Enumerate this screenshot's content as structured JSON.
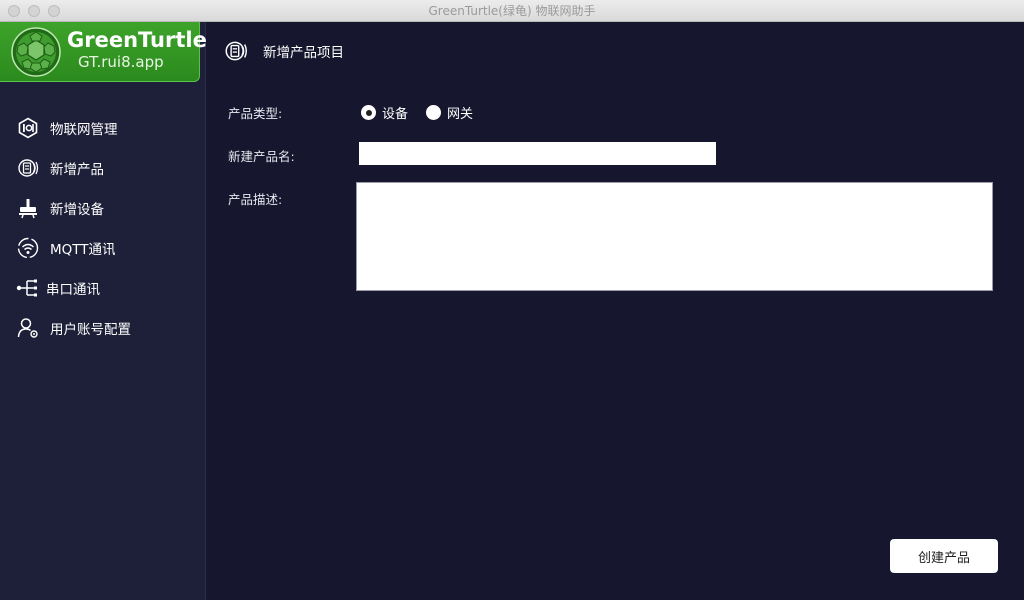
{
  "window": {
    "title": "GreenTurtle(绿龟) 物联网助手"
  },
  "logo": {
    "name": "GreenTurtle",
    "url": "GT.rui8.app"
  },
  "sidebar": {
    "items": [
      {
        "label": "物联网管理",
        "icon": "iot-icon"
      },
      {
        "label": "新增产品",
        "icon": "product-icon"
      },
      {
        "label": "新增设备",
        "icon": "device-icon"
      },
      {
        "label": "MQTT通讯",
        "icon": "mqtt-icon"
      },
      {
        "label": "串口通讯",
        "icon": "serial-icon"
      },
      {
        "label": "用户账号配置",
        "icon": "user-settings-icon"
      }
    ]
  },
  "main": {
    "header": {
      "title": "新增产品项目",
      "icon": "product-icon"
    },
    "form": {
      "type_label": "产品类型:",
      "type_options": [
        {
          "label": "设备",
          "checked": true
        },
        {
          "label": "网关",
          "checked": false
        }
      ],
      "name_label": "新建产品名:",
      "name_value": "",
      "desc_label": "产品描述:",
      "desc_value": ""
    },
    "create_button": "创建产品"
  },
  "colors": {
    "background": "#16162e",
    "sidebar": "#1e1f38",
    "logo_green": "#2b8a1d"
  }
}
